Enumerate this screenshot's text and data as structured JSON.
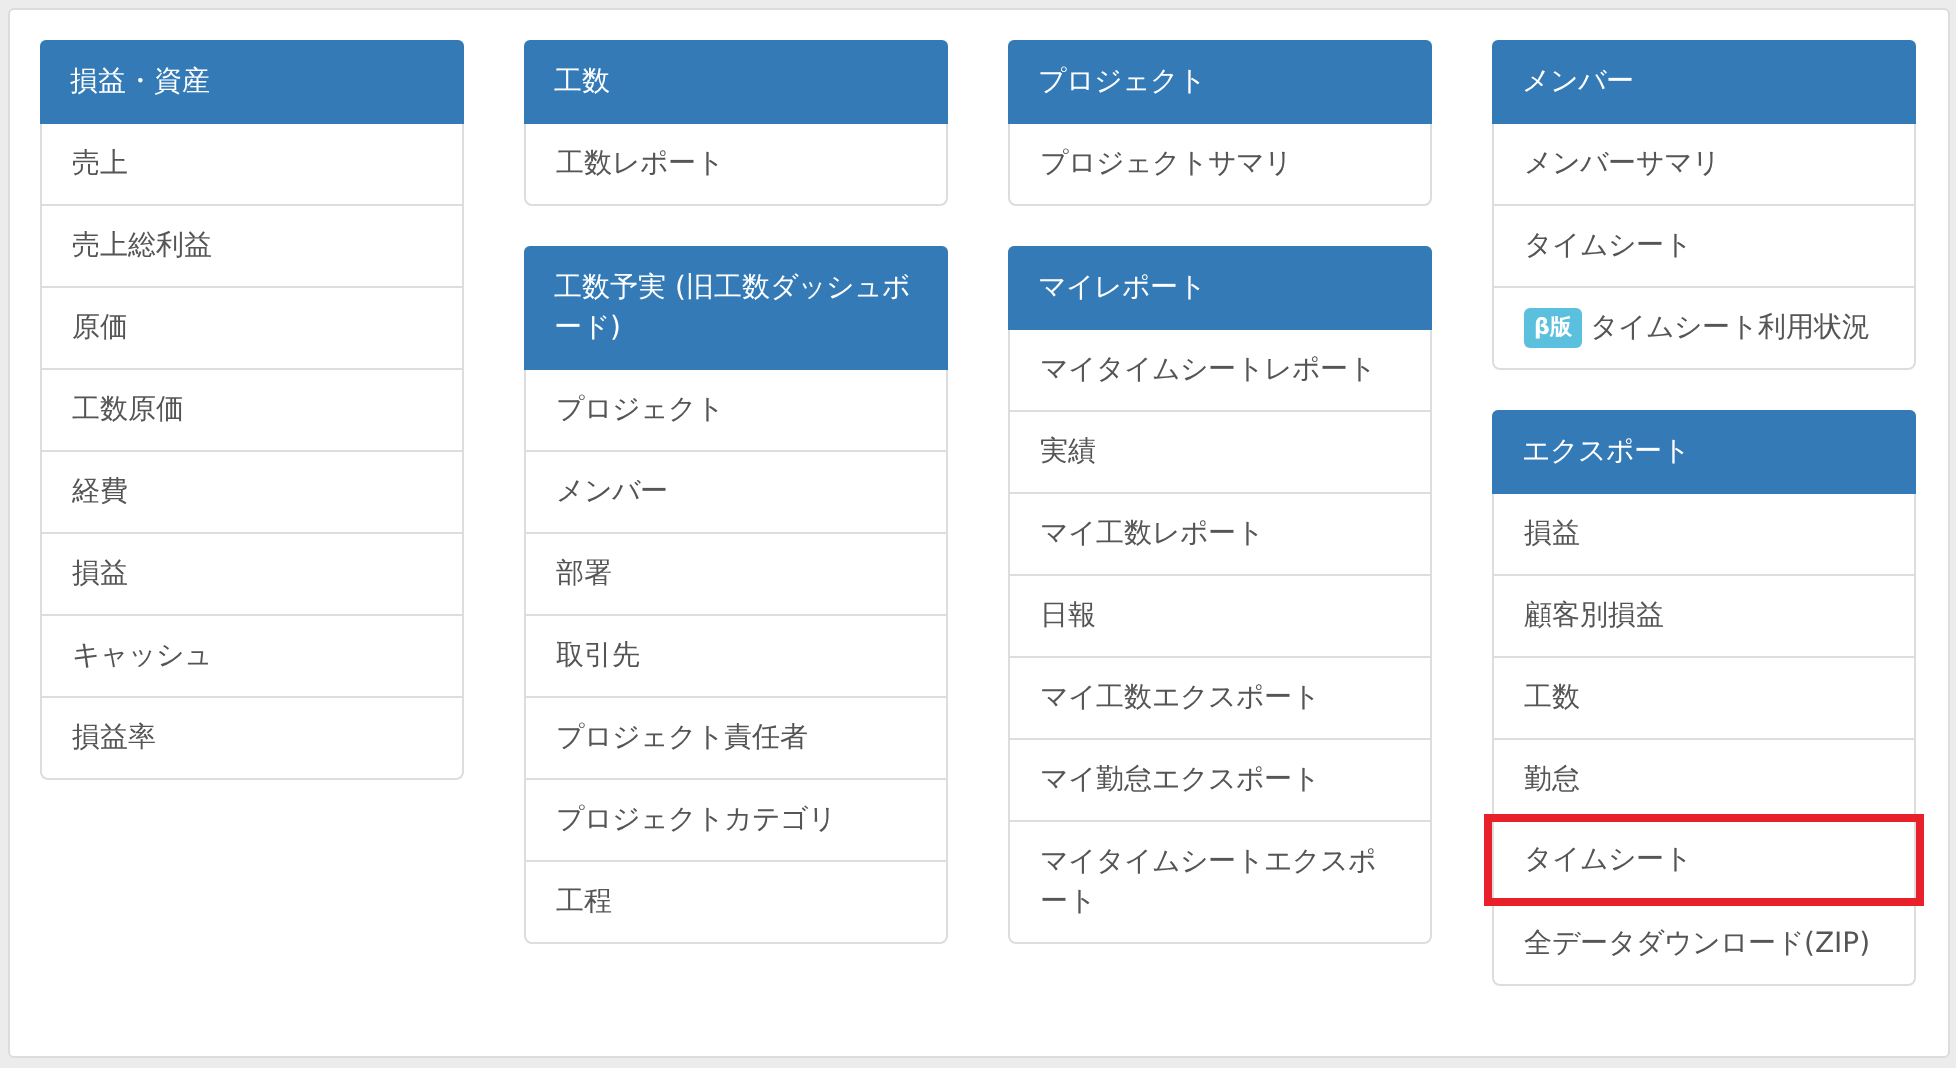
{
  "columns": [
    [
      {
        "title": "損益・資産",
        "items": [
          {
            "label": "売上",
            "highlighted": false
          },
          {
            "label": "売上総利益",
            "highlighted": false
          },
          {
            "label": "原価",
            "highlighted": false
          },
          {
            "label": "工数原価",
            "highlighted": false
          },
          {
            "label": "経費",
            "highlighted": false
          },
          {
            "label": "損益",
            "highlighted": false
          },
          {
            "label": "キャッシュ",
            "highlighted": false
          },
          {
            "label": "損益率",
            "highlighted": false
          }
        ]
      }
    ],
    [
      {
        "title": "工数",
        "items": [
          {
            "label": "工数レポート",
            "highlighted": false
          }
        ]
      },
      {
        "title": "工数予実 (旧工数ダッシュボード)",
        "items": [
          {
            "label": "プロジェクト",
            "highlighted": false
          },
          {
            "label": "メンバー",
            "highlighted": false
          },
          {
            "label": "部署",
            "highlighted": false
          },
          {
            "label": "取引先",
            "highlighted": false
          },
          {
            "label": "プロジェクト責任者",
            "highlighted": false
          },
          {
            "label": "プロジェクトカテゴリ",
            "highlighted": false
          },
          {
            "label": "工程",
            "highlighted": false
          }
        ]
      }
    ],
    [
      {
        "title": "プロジェクト",
        "items": [
          {
            "label": "プロジェクトサマリ",
            "highlighted": false
          }
        ]
      },
      {
        "title": "マイレポート",
        "items": [
          {
            "label": "マイタイムシートレポート",
            "highlighted": false
          },
          {
            "label": "実績",
            "highlighted": false
          },
          {
            "label": "マイ工数レポート",
            "highlighted": false
          },
          {
            "label": "日報",
            "highlighted": false
          },
          {
            "label": "マイ工数エクスポート",
            "highlighted": false
          },
          {
            "label": "マイ勤怠エクスポート",
            "highlighted": false
          },
          {
            "label": "マイタイムシートエクスポート",
            "highlighted": false
          }
        ]
      }
    ],
    [
      {
        "title": "メンバー",
        "items": [
          {
            "label": "メンバーサマリ",
            "highlighted": false
          },
          {
            "label": "タイムシート",
            "highlighted": false
          },
          {
            "label": "タイムシート利用状況",
            "badge": "β版",
            "highlighted": false
          }
        ]
      },
      {
        "title": "エクスポート",
        "items": [
          {
            "label": "損益",
            "highlighted": false
          },
          {
            "label": "顧客別損益",
            "highlighted": false
          },
          {
            "label": "工数",
            "highlighted": false
          },
          {
            "label": "勤怠",
            "highlighted": false
          },
          {
            "label": "タイムシート",
            "highlighted": true
          },
          {
            "label": "全データダウンロード(ZIP)",
            "highlighted": false
          }
        ]
      }
    ]
  ]
}
